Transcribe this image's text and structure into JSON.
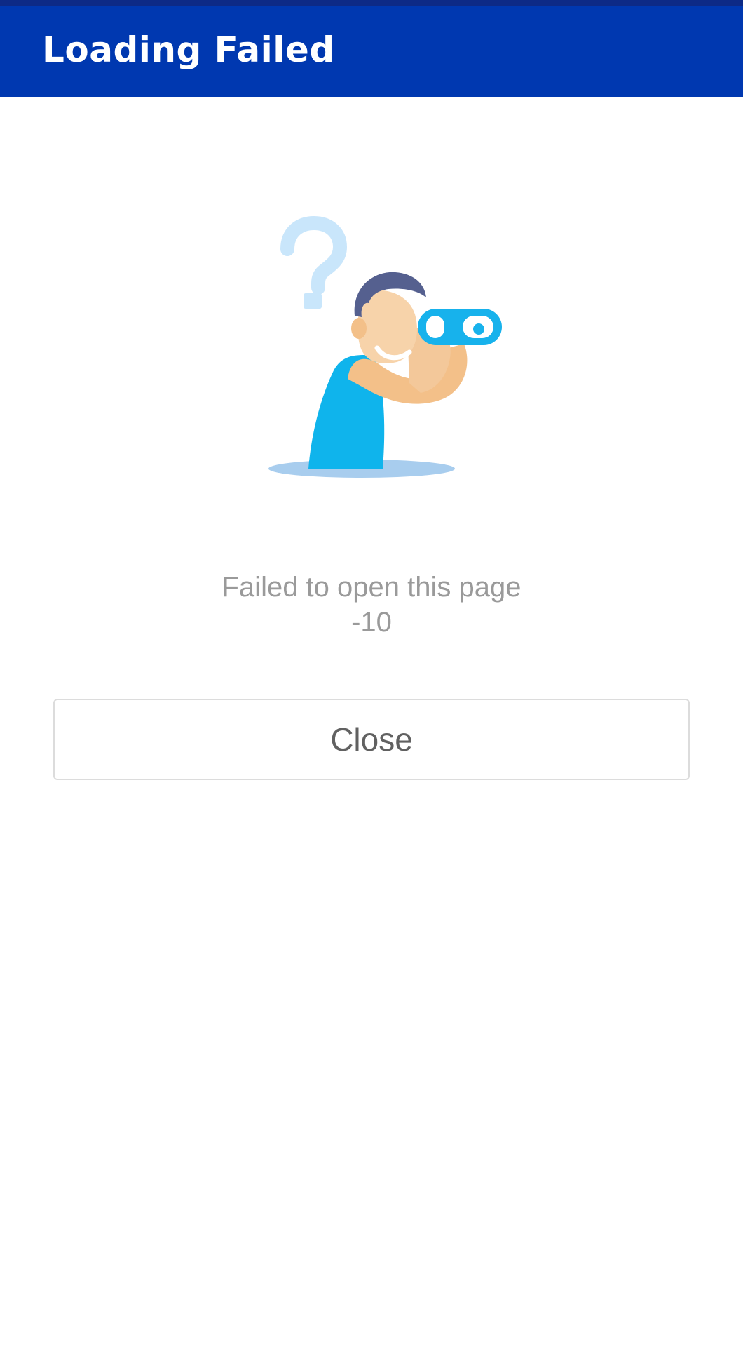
{
  "app_bar": {
    "title": "Loading Failed",
    "background_color": "#0038b0"
  },
  "illustration": {
    "icon": "person-with-binoculars-icon",
    "secondary_icon": "question-mark-icon"
  },
  "error": {
    "message": "Failed to open this page",
    "code": "-10",
    "text_color": "#9a9a9a"
  },
  "actions": {
    "close_label": "Close"
  }
}
